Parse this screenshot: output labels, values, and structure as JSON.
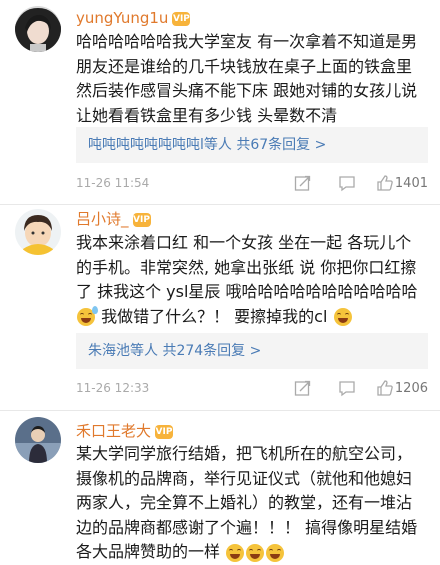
{
  "comments": [
    {
      "username": "yungYung1u",
      "vip_badge": "VIP",
      "text_segments": [
        "哈哈哈哈哈哈我大学室友 有一次拿着不知道是男朋友还是谁给的几千块钱放在桌子上面的铁盒里 然后装作感冒头痛不能下床 跟她对铺的女孩儿说 让她看看铁盒里有多少钱 头晕数不清"
      ],
      "reply_names": "吨吨吨吨吨吨吨吨l等人",
      "reply_count": "共67条回复",
      "reply_arrow": ">",
      "time": "11-26 11:54",
      "likes": "1401"
    },
    {
      "username": "吕小诗_",
      "vip_badge": "VIP",
      "text_segments": [
        "我本来涂着口红 和一个女孩 坐在一起 各玩儿个的手机。非常突然, 她拿出张纸 说 你把你口红擦了 抹我这个 ysl星辰 哦哈哈哈哈哈哈哈哈哈哈哈",
        "我做错了什么？！ 要擦掉我的cl"
      ],
      "reply_names": "朱海池等人",
      "reply_count": "共274条回复",
      "reply_arrow": ">",
      "time": "11-26 12:33",
      "likes": "1206"
    },
    {
      "username": "禾口王老大",
      "vip_badge": "VIP",
      "text_segments": [
        "某大学同学旅行结婚，把飞机所在的航空公司，摄像机的品牌商，举行见证仪式（就他和他媳妇两家人，完全算不上婚礼）的教堂，还有一堆沾边的品牌商都感谢了个遍！！！ 搞得像明星结婚各大品牌赞助的一样"
      ]
    }
  ],
  "colors": {
    "username": "#e0792c",
    "reply_link": "#4a7bb5",
    "meta": "#aaaaaa",
    "emoji": "#f5c33b"
  },
  "icons": [
    "share-icon",
    "comment-icon",
    "like-icon",
    "laugh-cry-emoji",
    "sweat-laugh-emoji"
  ]
}
